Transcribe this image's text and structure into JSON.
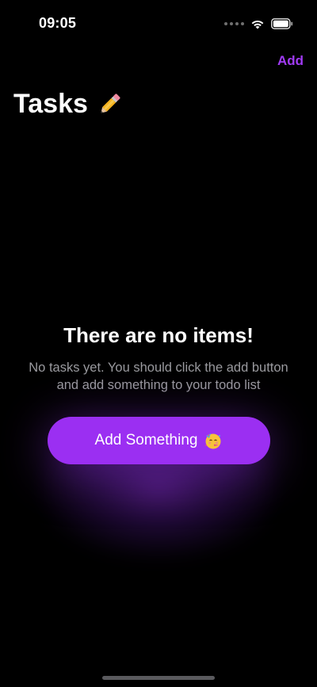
{
  "status_bar": {
    "time": "09:05"
  },
  "nav": {
    "add_label": "Add",
    "title": "Tasks"
  },
  "empty_state": {
    "heading": "There are no items!",
    "message": "No tasks yet. You should click the add button and add something to your todo list",
    "button_label": "Add Something"
  },
  "icons": {
    "title_emoji": "pencil-icon",
    "button_emoji": "partying-face-icon",
    "wifi": "wifi-icon",
    "battery": "battery-icon"
  },
  "colors": {
    "background": "#000000",
    "accent": "#9b2ff2",
    "nav_accent": "#a13bf5",
    "secondary_text": "#9a9a9f"
  }
}
